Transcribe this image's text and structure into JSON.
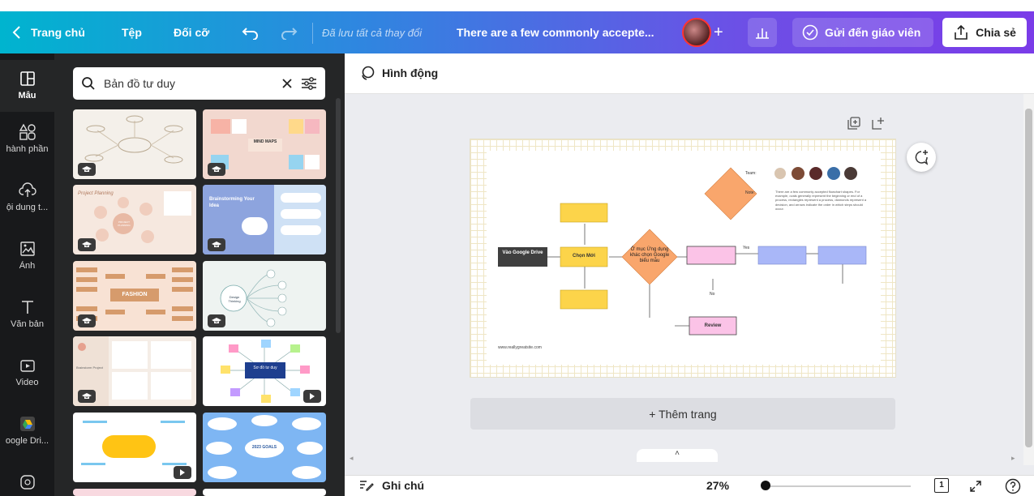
{
  "topbar": {
    "home": "Trang chủ",
    "file": "Tệp",
    "resize": "Đối cỡ",
    "saved": "Đã lưu tất cả thay đổi",
    "title": "There are a few commonly accepte...",
    "send_teacher": "Gửi đến giáo viên",
    "share": "Chia sẻ"
  },
  "rail": {
    "items": [
      {
        "label": "Mẫu",
        "icon": "template-icon"
      },
      {
        "label": "hành phần",
        "icon": "elements-icon"
      },
      {
        "label": "ội dung t...",
        "icon": "upload-icon"
      },
      {
        "label": "Ảnh",
        "icon": "photo-icon"
      },
      {
        "label": "Văn bản",
        "icon": "text-icon"
      },
      {
        "label": "Video",
        "icon": "video-icon"
      },
      {
        "label": "oogle Dri...",
        "icon": "google-drive-icon"
      }
    ]
  },
  "search": {
    "value": "Bản đồ tư duy"
  },
  "templates": {
    "t2": "MIND MAPS",
    "t3": "Project Planning",
    "t3b": "PROJECT PLANNING",
    "t4": "Brainstorming Your Idea",
    "t5": "FASHION",
    "t6": "Design Thinking",
    "t7a": "Presentation",
    "t7b": "Brainstorm Project",
    "t8": "Sơ đồ tư duy",
    "t10": "2023 GOALS"
  },
  "editor": {
    "animate": "Hình động",
    "add_page": "+ Thêm trang",
    "notes": "Ghi chú",
    "zoom": "27%",
    "page_number": "1"
  },
  "flowchart": {
    "start": "Vào Google Drive",
    "step1": "Chọn Mới",
    "decision": "Ở mục Ứng dụng khác chọn Google biểu mẫu",
    "yes": "Yes",
    "no": "No",
    "review": "Review",
    "team": "Team:",
    "note": "Note:",
    "note_text": "There are a few commonly accepted flowchart shapes. For example, ovals generally represent the beginning or end of a process, rectangles represent a process, diamonds represent a decision, and arrows indicate the order in which steps should occur.",
    "website": "www.reallygreatsite.com"
  },
  "colors": {
    "accent_purple": "#7a3ce8",
    "accent_teal": "#00b4cf",
    "rail_bg": "#18191b",
    "panel_bg": "#252627",
    "yellow_box": "#fcd44a",
    "orange_diamond": "#f9a66c",
    "pink_box": "#fbc3e7",
    "blue_box": "#a9b7f8"
  }
}
